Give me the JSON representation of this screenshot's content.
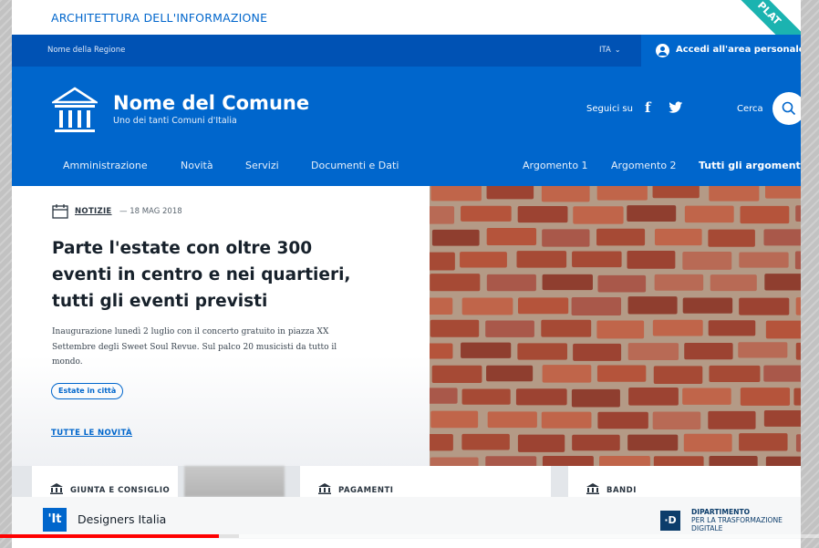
{
  "video": {
    "caption": "ARCHITETTURA DELL'INFORMAZIONE",
    "corner_ribbon": "PLAT",
    "progress_played": 0.267,
    "progress_buffered": 0.292
  },
  "slim_header": {
    "region": "Nome della Regione",
    "language": "ITA",
    "login_label": "Accedi all'area personale"
  },
  "header": {
    "site_name": "Nome del Comune",
    "tagline": "Uno dei tanti Comuni d'Italia",
    "social_label": "Seguici su",
    "social_icons": [
      "facebook-icon",
      "twitter-icon"
    ],
    "search_label": "Cerca"
  },
  "nav": {
    "main": [
      "Amministrazione",
      "Novità",
      "Servizi",
      "Documenti e Dati"
    ],
    "topics": [
      "Argomento 1",
      "Argomento 2"
    ],
    "all_topics": "Tutti gli argomenti..."
  },
  "featured": {
    "category": "NOTIZIE",
    "date": "— 18 MAG 2018",
    "headline": "Parte l'estate con oltre 300 eventi in centro e nei quartieri, tutti gli eventi previsti",
    "summary": "Inaugurazione lunedì 2 luglio con il concerto gratuito in piazza XX Settembre degli Sweet Soul Revue. Sul palco 20 musicisti da tutto il mondo.",
    "tag": "Estate in città",
    "all_news_link": "TUTTE LE NOVITÀ"
  },
  "cards": [
    "GIUNTA E CONSIGLIO",
    "PAGAMENTI",
    "BANDI"
  ],
  "footer_overlay": {
    "left_logo": "'It",
    "left_name": "Designers Italia",
    "right_logo": "·D",
    "right_line1": "DIPARTIMENTO",
    "right_line2": "PER LA TRASFORMAZIONE",
    "right_line3": "DIGITALE"
  },
  "colors": {
    "primary": "#0066cc",
    "primary_dark": "#0052b4",
    "ribbon": "#1bb3b0",
    "progress": "#ff0000"
  }
}
